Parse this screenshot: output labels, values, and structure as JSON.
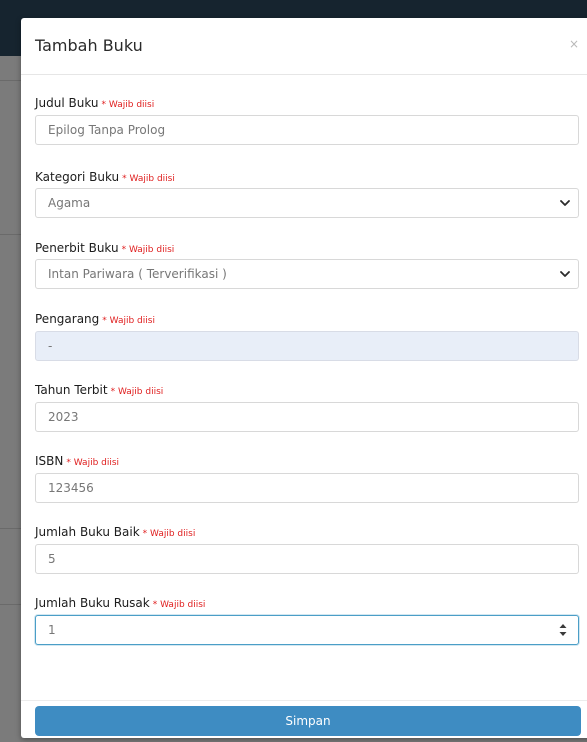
{
  "modal": {
    "title": "Tambah Buku",
    "close_icon": "close-icon"
  },
  "required_label": "* Wajib diisi",
  "fields": [
    {
      "label": "Judul Buku",
      "value": "Epilog Tanpa Prolog",
      "type": "text"
    },
    {
      "label": "Kategori Buku",
      "value": "Agama",
      "type": "select"
    },
    {
      "label": "Penerbit Buku",
      "value": "Intan Pariwara ( Terverifikasi )",
      "type": "select"
    },
    {
      "label": "Pengarang",
      "value": "-",
      "type": "disabled"
    },
    {
      "label": "Tahun Terbit",
      "value": "2023",
      "type": "text"
    },
    {
      "label": "ISBN",
      "value": "123456",
      "type": "text"
    },
    {
      "label": "Jumlah Buku Baik",
      "value": "5",
      "type": "text"
    },
    {
      "label": "Jumlah Buku Rusak",
      "value": "1",
      "type": "number"
    }
  ],
  "footer": {
    "save_label": "Simpan"
  },
  "colors": {
    "accent": "#3e8cc2",
    "required": "#e02020",
    "disabled_bg": "#e8eef8",
    "topbar": "#16242f"
  }
}
